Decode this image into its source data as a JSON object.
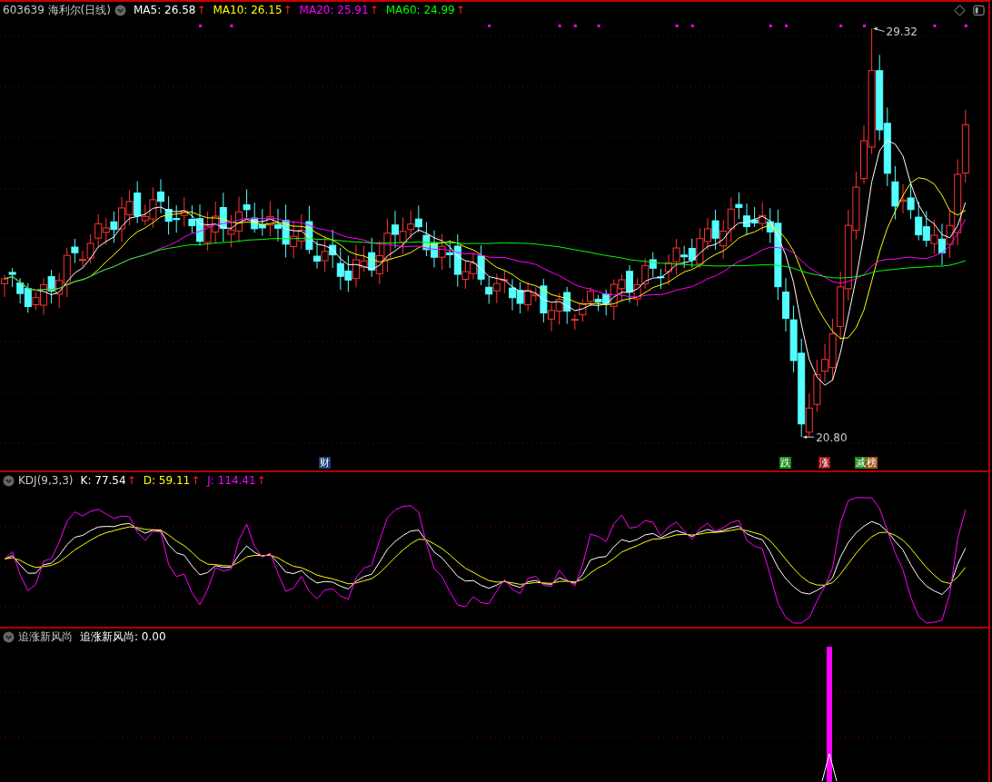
{
  "main": {
    "symbol": "603639",
    "name": "海利尔(日线)",
    "indicators": [
      {
        "label": "MA5: 26.58",
        "color": "#ffffff",
        "arrow": "↑"
      },
      {
        "label": "MA10: 26.15",
        "color": "#ffff00",
        "arrow": "↑"
      },
      {
        "label": "MA20: 25.91",
        "color": "#ff00ff",
        "arrow": "↑"
      },
      {
        "label": "MA60: 24.99",
        "color": "#00ff00",
        "arrow": "↑"
      }
    ],
    "high_label": "29.32",
    "low_label": "20.80",
    "event_tags": [
      {
        "text": "财",
        "color": "#1c3f7a"
      },
      {
        "text": "跌",
        "color": "#1a8a1a"
      },
      {
        "text": "涨",
        "color": "#9a1010"
      },
      {
        "text": "减",
        "color": "#1a8a1a"
      },
      {
        "text": "榜",
        "color": "#a0561a"
      }
    ]
  },
  "kdj": {
    "title": "KDJ(9,3,3)",
    "indicators": [
      {
        "label": "K: 77.54",
        "color": "#ffffff",
        "arrow": "↑"
      },
      {
        "label": "D: 59.11",
        "color": "#ffff00",
        "arrow": "↑"
      },
      {
        "label": "J: 114.41",
        "color": "#ff00ff",
        "arrow": "↑"
      }
    ]
  },
  "custom": {
    "title": "追涨新风尚",
    "reading": "追涨新风尚: 0.00"
  }
}
